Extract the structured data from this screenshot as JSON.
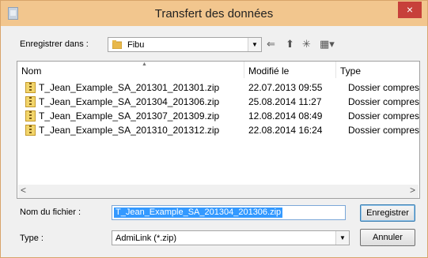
{
  "window": {
    "title": "Transfert des données",
    "close_glyph": "×"
  },
  "save_in": {
    "label": "Enregistrer dans :",
    "value": "Fibu",
    "icon": "folder-icon"
  },
  "toolbar": {
    "back_icon": "arrow-left-icon",
    "back_glyph": "⇐",
    "up_icon": "folder-up-icon",
    "up_glyph": "⬆",
    "new_folder_icon": "new-folder-icon",
    "new_folder_glyph": "✳",
    "views_icon": "view-menu-icon",
    "views_glyph": "▦▾"
  },
  "list": {
    "columns": [
      "Nom",
      "Modifié le",
      "Type"
    ],
    "sort_indicator": "▲",
    "files": [
      {
        "name": "T_Jean_Example_SA_201301_201301.zip",
        "modified": "22.07.2013 09:55",
        "type": "Dossier compres"
      },
      {
        "name": "T_Jean_Example_SA_201304_201306.zip",
        "modified": "25.08.2014 11:27",
        "type": "Dossier compres"
      },
      {
        "name": "T_Jean_Example_SA_201307_201309.zip",
        "modified": "12.08.2014 08:49",
        "type": "Dossier compres"
      },
      {
        "name": "T_Jean_Example_SA_201310_201312.zip",
        "modified": "22.08.2014 16:24",
        "type": "Dossier compres"
      }
    ],
    "scroll_left": "<",
    "scroll_right": ">"
  },
  "filename": {
    "label": "Nom du fichier :",
    "value": "T_Jean_Example_SA_201304_201306.zip"
  },
  "filetype": {
    "label": "Type :",
    "value": "AdmiLink (*.zip)"
  },
  "buttons": {
    "save": "Enregistrer",
    "cancel": "Annuler"
  },
  "colors": {
    "titlebar": "#f2c68e",
    "close": "#c7403a",
    "selection": "#3399ff",
    "folder": "#f2d56b"
  }
}
